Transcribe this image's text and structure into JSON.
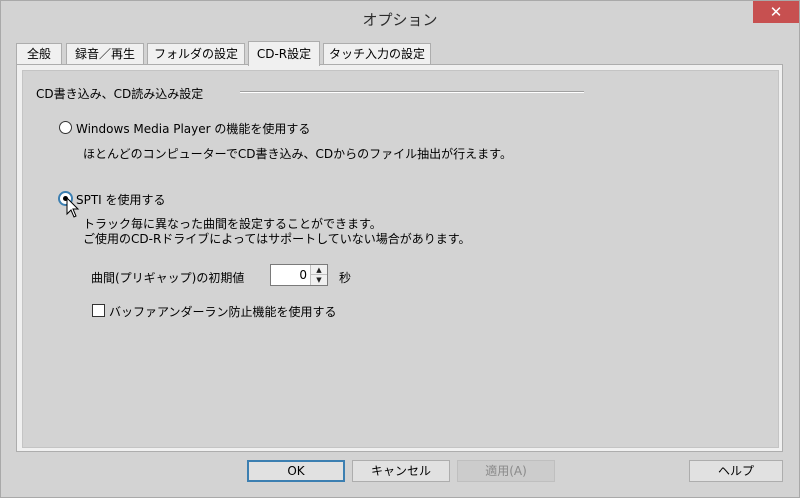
{
  "window": {
    "title": "オプション",
    "close_glyph": "✕"
  },
  "tabs": [
    {
      "label": "全般",
      "active": false
    },
    {
      "label": "録音／再生",
      "active": false
    },
    {
      "label": "フォルダの設定",
      "active": false
    },
    {
      "label": "CD-R設定",
      "active": true
    },
    {
      "label": "タッチ入力の設定",
      "active": false
    }
  ],
  "group": {
    "title": "CD書き込み、CD読み込み設定"
  },
  "options": {
    "wmp": {
      "label": "Windows Media Player の機能を使用する",
      "description": "ほとんどのコンピューターでCD書き込み、CDからのファイル抽出が行えます。",
      "checked": false
    },
    "spti": {
      "label": "SPTI を使用する",
      "description_line1": "トラック毎に異なった曲間を設定することができます。",
      "description_line2": "ご使用のCD-Rドライブによってはサポートしていない場合があります。",
      "checked": true
    }
  },
  "gap": {
    "label": "曲間(プリギャップ)の初期値",
    "value": "0",
    "unit": "秒"
  },
  "buffer": {
    "label": "バッファアンダーラン防止機能を使用する",
    "checked": false
  },
  "buttons": {
    "ok": "OK",
    "cancel": "キャンセル",
    "apply": "適用(A)",
    "help": "ヘルプ"
  }
}
